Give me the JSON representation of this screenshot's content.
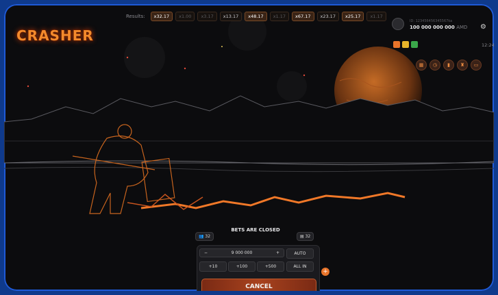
{
  "game": {
    "logo_text": "CRASHER"
  },
  "results": {
    "label": "Results:",
    "items": [
      {
        "value": "x32.17",
        "style": "hi"
      },
      {
        "value": "x1.00",
        "style": "dim"
      },
      {
        "value": "x3.17",
        "style": "dim"
      },
      {
        "value": "x13.17",
        "style": "mid"
      },
      {
        "value": "x48.17",
        "style": "hi"
      },
      {
        "value": "x1.17",
        "style": "dim"
      },
      {
        "value": "x67.17",
        "style": "hi"
      },
      {
        "value": "x23.17",
        "style": "mid"
      },
      {
        "value": "x25.17",
        "style": "hi"
      },
      {
        "value": "x1.17",
        "style": "dim"
      }
    ]
  },
  "account": {
    "id_text": "ID: 123456456345567ka",
    "balance": "100 000 000 000",
    "currency": "AMD"
  },
  "clock": "12:24",
  "betting": {
    "status": "BETS ARE CLOSED",
    "players_count": "32",
    "bets_count": "32",
    "amount": "9 000 000",
    "minus_label": "−",
    "plus_label": "+",
    "auto_label": "AUTO",
    "quick": [
      "+10",
      "+100",
      "+500",
      "ALL IN"
    ],
    "cancel_label": "CANCEL"
  },
  "icons": {
    "settings": "gear-icon",
    "players": "users-icon",
    "bets": "ticket-icon",
    "badges": [
      "gift-icon",
      "bonus-icon",
      "promo-icon"
    ],
    "bottom": [
      "history-icon",
      "clock-icon",
      "leaderboard-icon",
      "trophy-icon",
      "chat-icon"
    ]
  },
  "colors": {
    "accent": "#e8742a",
    "frame": "#1e5ad8",
    "lava": "#f07828",
    "background": "#0c0c0e"
  }
}
